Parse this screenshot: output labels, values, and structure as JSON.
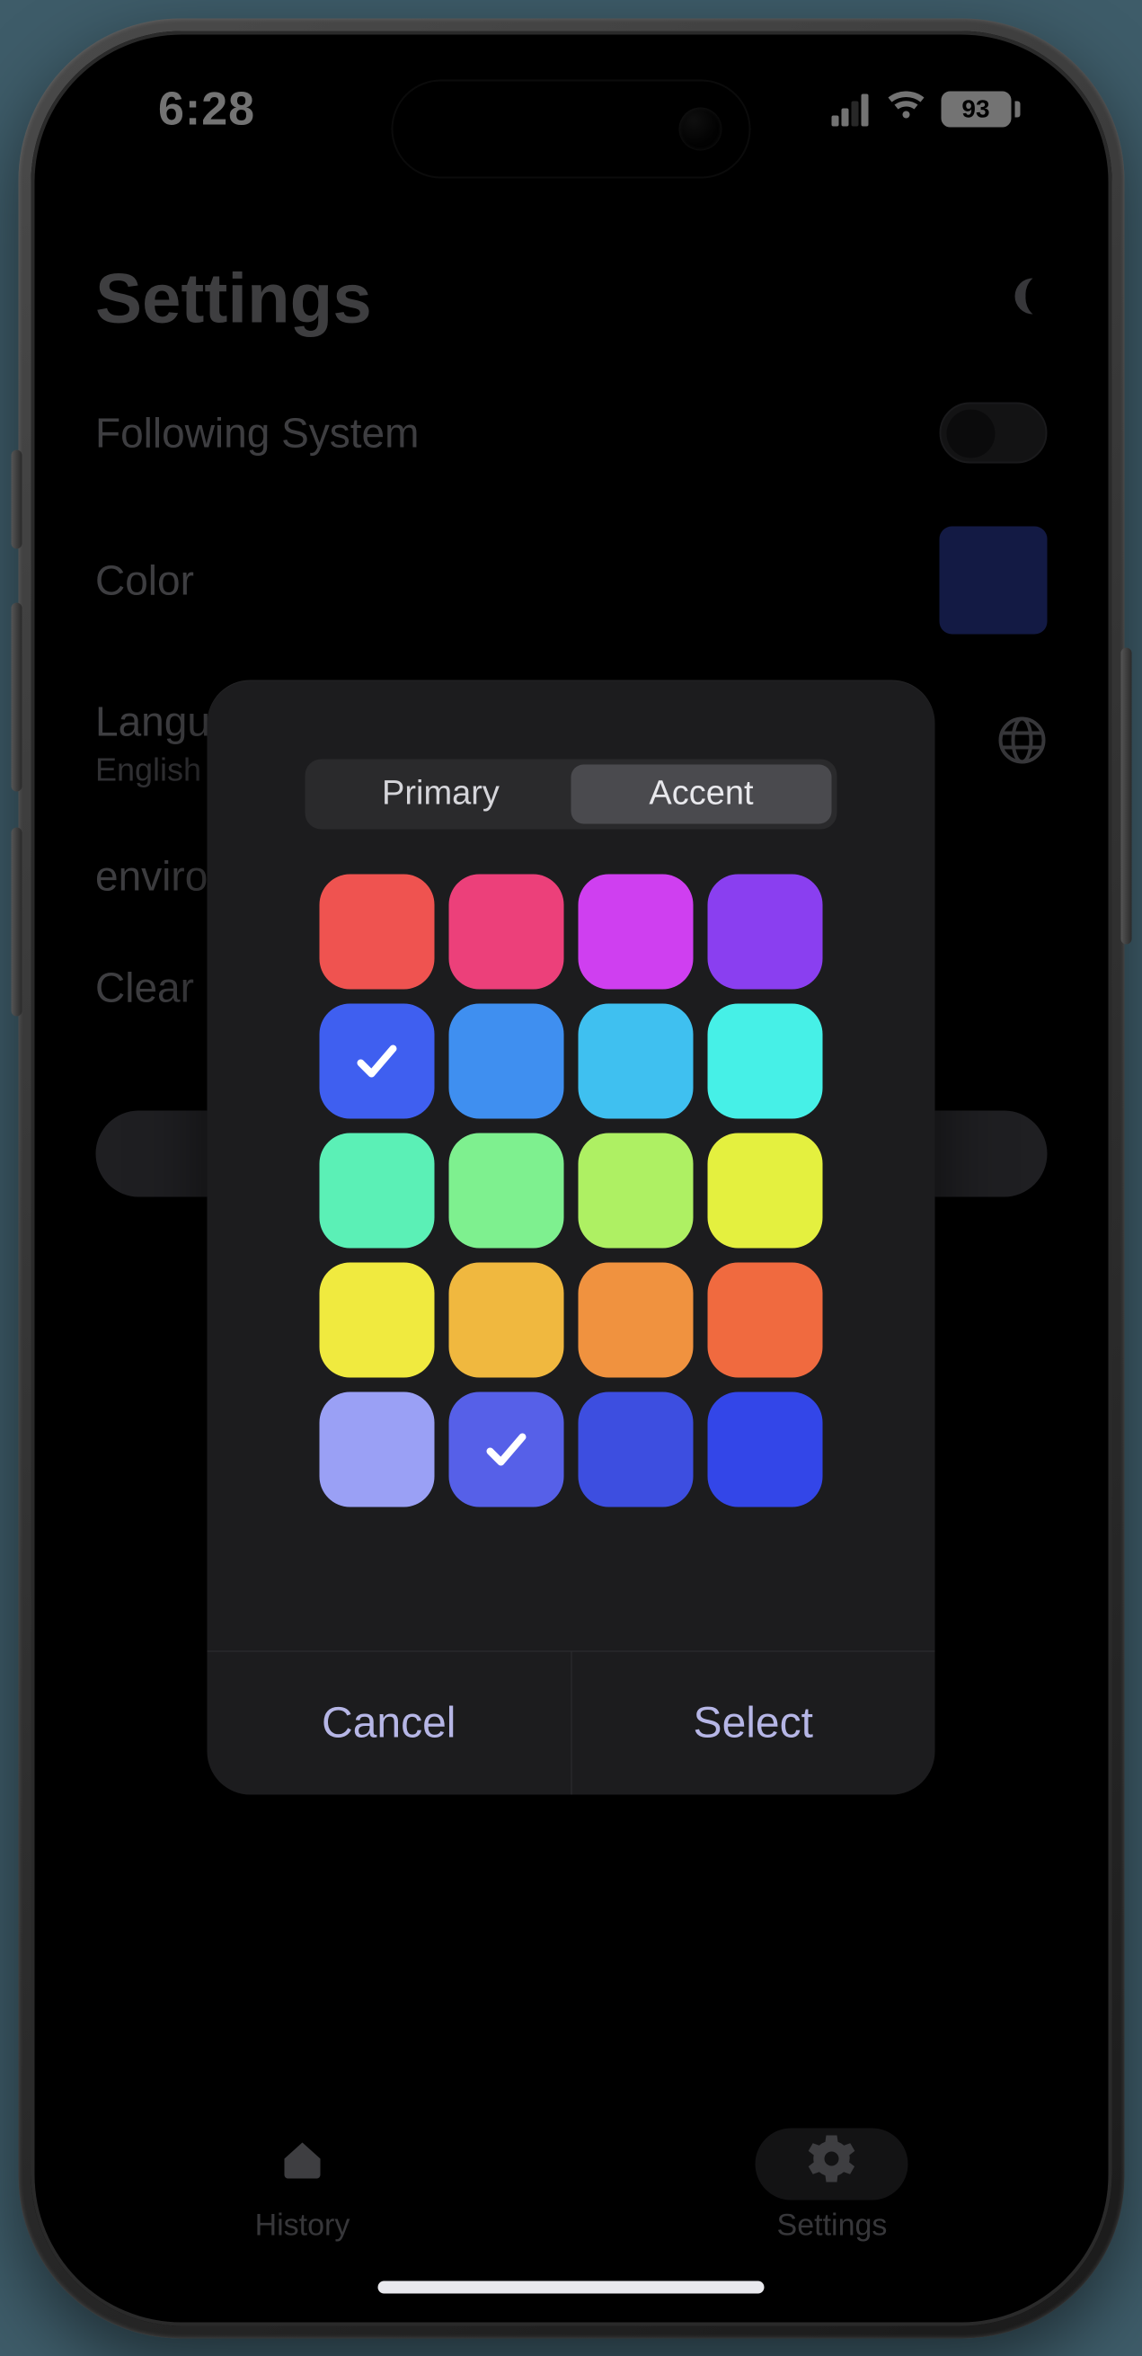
{
  "status": {
    "time": "6:28",
    "battery": "93"
  },
  "page": {
    "title": "Settings",
    "rows": {
      "follow_system": "Following System",
      "color": "Color",
      "language_label": "Langu",
      "language_value": "English",
      "environment": "enviro",
      "clear": "Clear"
    },
    "current_color": "#2c3a97"
  },
  "modal": {
    "tabs": {
      "primary": "Primary",
      "accent": "Accent",
      "active": "accent"
    },
    "actions": {
      "cancel": "Cancel",
      "select": "Select"
    },
    "colors": [
      {
        "hex": "#ef5350",
        "selected": false
      },
      {
        "hex": "#ec407a",
        "selected": false
      },
      {
        "hex": "#cf3ff0",
        "selected": false
      },
      {
        "hex": "#8a3ff0",
        "selected": false
      },
      {
        "hex": "#3f5ff0",
        "selected": true
      },
      {
        "hex": "#3f8ff0",
        "selected": false
      },
      {
        "hex": "#3fc0f0",
        "selected": false
      },
      {
        "hex": "#46f0e7",
        "selected": false
      },
      {
        "hex": "#5bf0b6",
        "selected": false
      },
      {
        "hex": "#7ef08f",
        "selected": false
      },
      {
        "hex": "#aef063",
        "selected": false
      },
      {
        "hex": "#e4f03f",
        "selected": false
      },
      {
        "hex": "#f0ea3f",
        "selected": false
      },
      {
        "hex": "#f0b83f",
        "selected": false
      },
      {
        "hex": "#f0923f",
        "selected": false
      },
      {
        "hex": "#f06a3f",
        "selected": false
      },
      {
        "hex": "#9aa0f5",
        "selected": false
      },
      {
        "hex": "#5660e8",
        "selected": true
      },
      {
        "hex": "#3d4ee0",
        "selected": false
      },
      {
        "hex": "#3346e8",
        "selected": false
      }
    ]
  },
  "tabs": {
    "history": "History",
    "settings": "Settings"
  }
}
